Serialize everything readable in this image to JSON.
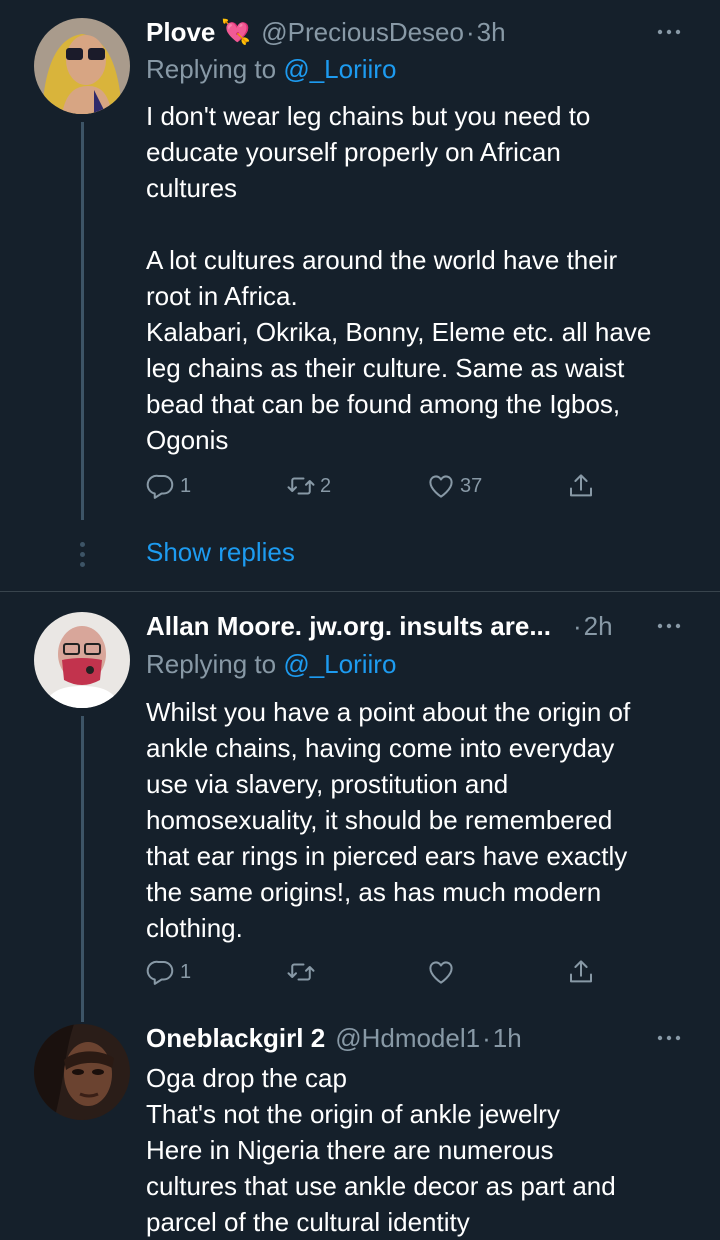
{
  "tweets": [
    {
      "name": "Plove",
      "emoji": "💘",
      "handle": "@PreciousDeseo",
      "sep": "·",
      "time": "3h",
      "reply_label": "Replying to",
      "reply_to": "@_Loriiro",
      "text": [
        "I don't wear leg chains but you need to",
        "educate yourself properly on African",
        "cultures",
        "",
        "A lot cultures around the world have their",
        "root in Africa.",
        "Kalabari, Okrika, Bonny, Eleme etc. all have",
        "leg chains as their culture. Same as waist",
        "bead that can be found among the Igbos,",
        "Ogonis"
      ],
      "replies": "1",
      "retweets": "2",
      "likes": "37"
    },
    {
      "name": "Allan Moore. jw.org. insults are...",
      "handle": "",
      "sep": "·",
      "time": "2h",
      "reply_label": "Replying to",
      "reply_to": "@_Loriiro",
      "text": [
        "Whilst you have a point about the origin of",
        "ankle chains, having come into everyday",
        "use via slavery, prostitution and",
        "homosexuality, it should be remembered",
        "that ear rings in pierced ears have exactly",
        "the same origins!, as has much modern",
        "clothing."
      ],
      "replies": "1",
      "retweets": "",
      "likes": ""
    },
    {
      "name": "Oneblackgirl 2",
      "handle": "@Hdmodel1",
      "sep": "·",
      "time": "1h",
      "text": [
        "Oga drop the cap",
        "That's not the origin of ankle jewelry",
        "Here in Nigeria there are numerous",
        "cultures that use ankle decor as part and",
        "parcel of the cultural identity"
      ]
    }
  ],
  "show_replies": "Show replies",
  "colors": {
    "background": "#15202b",
    "link": "#1d9bf0",
    "muted": "#8899a6",
    "divider": "#38444d"
  },
  "icons": [
    "reply-icon",
    "retweet-icon",
    "like-icon",
    "share-icon",
    "more-icon"
  ]
}
